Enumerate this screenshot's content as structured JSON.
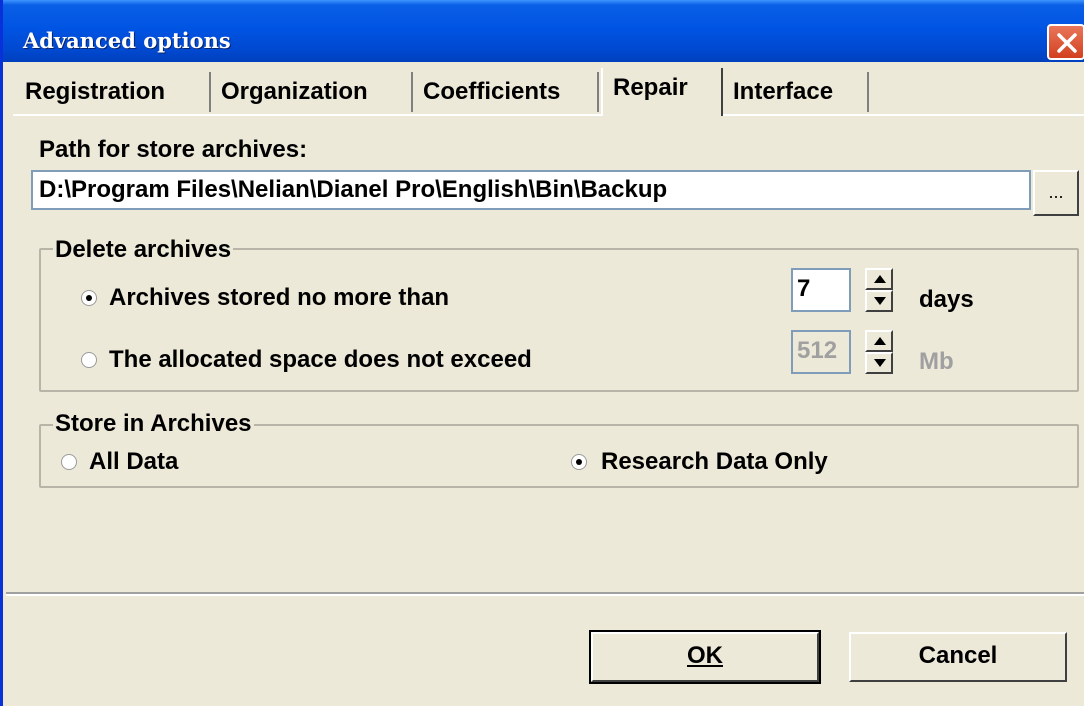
{
  "window": {
    "title": "Advanced options"
  },
  "tabs": [
    {
      "label": "Registration",
      "active": false
    },
    {
      "label": "Organization",
      "active": false
    },
    {
      "label": "Coefficients",
      "active": false
    },
    {
      "label": "Repair",
      "active": true
    },
    {
      "label": "Interface",
      "active": false
    }
  ],
  "path": {
    "label": "Path for store archives:",
    "value": "D:\\Program Files\\Nelian\\Dianel Pro\\English\\Bin\\Backup",
    "browse_label": "..."
  },
  "delete_archives": {
    "title": "Delete archives",
    "option_days": {
      "label": "Archives stored no more than",
      "selected": true,
      "value": "7",
      "unit": "days"
    },
    "option_space": {
      "label": "The allocated space does not exceed",
      "selected": false,
      "value": "512",
      "unit": "Mb"
    }
  },
  "store_in_archives": {
    "title": "Store in Archives",
    "option_all": {
      "label": "All Data",
      "selected": false
    },
    "option_research": {
      "label": "Research Data Only",
      "selected": true
    }
  },
  "buttons": {
    "ok": "OK",
    "cancel": "Cancel"
  },
  "colors": {
    "titlebar": "#0054e3",
    "face": "#ece9d8",
    "close": "#d2401f"
  },
  "icons": {
    "close": "close-icon",
    "spin_up": "arrow-up-icon",
    "spin_down": "arrow-down-icon"
  }
}
